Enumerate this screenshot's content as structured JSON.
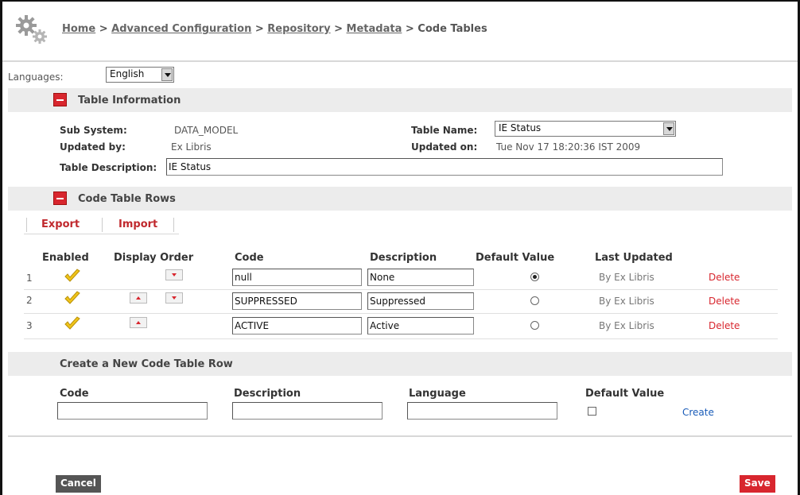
{
  "header": {
    "breadcrumb": [
      {
        "label": "Home",
        "link": true
      },
      {
        "label": " > ",
        "link": false
      },
      {
        "label": "Advanced Configuration",
        "link": true
      },
      {
        "label": " > ",
        "link": false
      },
      {
        "label": "Repository",
        "link": true
      },
      {
        "label": " > ",
        "link": false
      },
      {
        "label": "Metadata",
        "link": true
      },
      {
        "label": " > Code Tables",
        "link": false
      }
    ]
  },
  "languages": {
    "label": "Languages:",
    "selected": "English"
  },
  "table_info": {
    "title": "Table Information",
    "sub_system_label": "Sub System:",
    "sub_system_value": "DATA_MODEL",
    "updated_by_label": "Updated by:",
    "updated_by_value": "Ex Libris",
    "table_name_label": "Table Name:",
    "table_name_value": "IE Status",
    "updated_on_label": "Updated on:",
    "updated_on_value": "Tue Nov 17 18:20:36 IST 2009",
    "description_label": "Table Description:",
    "description_value": "IE Status"
  },
  "code_rows": {
    "title": "Code Table Rows",
    "export_label": "Export",
    "import_label": "Import",
    "columns": {
      "enabled": "Enabled",
      "display_order": "Display Order",
      "code": "Code",
      "description": "Description",
      "default_value": "Default Value",
      "last_updated": "Last Updated"
    },
    "rows": [
      {
        "num": "1",
        "code": "null",
        "description": "None",
        "default": true,
        "updated": "By Ex Libris",
        "delete": "Delete"
      },
      {
        "num": "2",
        "code": "SUPPRESSED",
        "description": "Suppressed",
        "default": false,
        "updated": "By Ex Libris",
        "delete": "Delete"
      },
      {
        "num": "3",
        "code": "ACTIVE",
        "description": "Active",
        "default": false,
        "updated": "By Ex Libris",
        "delete": "Delete"
      }
    ]
  },
  "new_row": {
    "title": "Create a New Code Table Row",
    "code_label": "Code",
    "description_label": "Description",
    "language_label": "Language",
    "default_label": "Default Value",
    "create_label": "Create"
  },
  "actions": {
    "cancel_label": "Cancel",
    "save_label": "Save"
  },
  "colors": {
    "accent": "#d8262e",
    "link_blue": "#1a5cb8",
    "section_bg": "#ececec",
    "cancel_bg": "#555555"
  }
}
